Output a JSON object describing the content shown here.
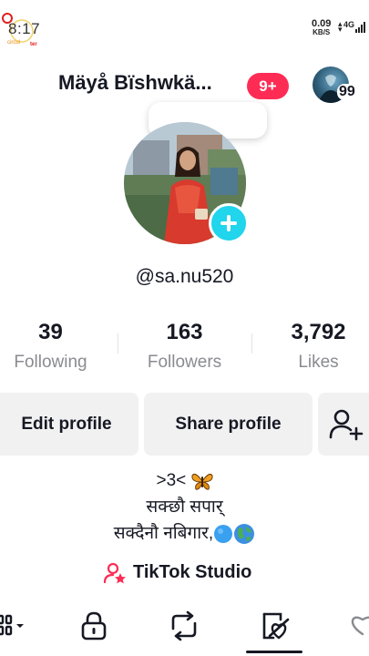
{
  "status_bar": {
    "time": "8:17",
    "speed_value": "0.09",
    "speed_unit": "KB/S",
    "network": "4G",
    "logo_text": "ter"
  },
  "header": {
    "display_name": "Mäyå Bïshwkä...",
    "notification_badge": "9+",
    "account_switch_count": "99"
  },
  "profile": {
    "username": "@sa.nu520"
  },
  "stats": {
    "following": {
      "value": "39",
      "label": "Following"
    },
    "followers": {
      "value": "163",
      "label": "Followers"
    },
    "likes": {
      "value": "3,792",
      "label": "Likes"
    }
  },
  "actions": {
    "edit_label": "Edit profile",
    "share_label": "Share profile"
  },
  "bio": {
    "line1": ">3<",
    "line2": "सक्छौ सपार्",
    "line3": "सक्दैनौ नबिगार,"
  },
  "studio": {
    "label": "TikTok Studio"
  },
  "colors": {
    "accent_red": "#fe2c55",
    "add_button_cyan": "#20d5ec",
    "text_primary": "#161823",
    "text_secondary": "#8a8b91",
    "button_bg": "#f1f1f2"
  },
  "icons": {
    "tabs": [
      "grid-icon",
      "lock-icon",
      "repost-icon",
      "liked-posts-icon",
      "favorites-icon"
    ]
  }
}
